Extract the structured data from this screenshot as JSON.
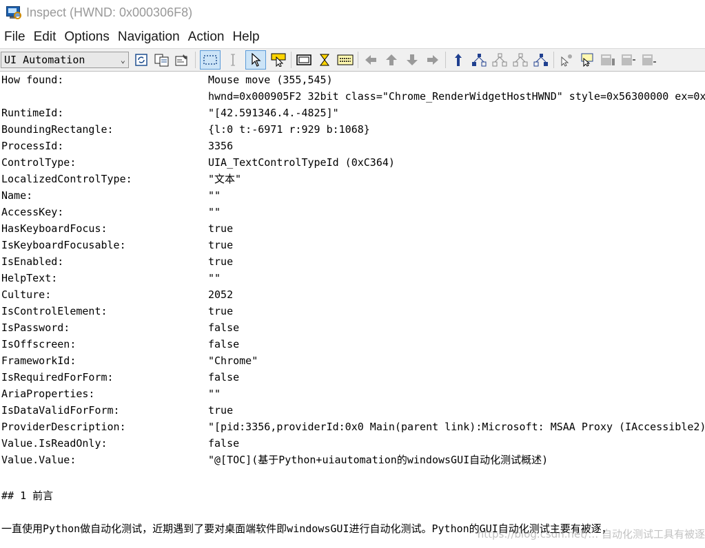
{
  "window": {
    "title": "Inspect  (HWND: 0x000306F8)",
    "icon": "inspect-app-icon"
  },
  "menu": [
    "File",
    "Edit",
    "Options",
    "Navigation",
    "Action",
    "Help"
  ],
  "toolbar": {
    "mode_selected": "UI Automation",
    "icons": [
      "refresh-icon",
      "copy-icon",
      "properties-icon",
      "watch-focus-icon",
      "watch-caret-icon",
      "watch-cursor-icon",
      "highlight-icon",
      "show-rectangle-icon",
      "hourglass-icon",
      "tooltip-icon",
      "navigate-left-icon",
      "navigate-up-icon",
      "navigate-down-icon",
      "navigate-right-icon",
      "parent-icon",
      "tree-first-child-icon",
      "tree-previous-icon",
      "tree-next-icon",
      "tree-last-child-icon",
      "default-action-icon",
      "select-icon",
      "scroll-icon",
      "expand-icon",
      "collapse-icon"
    ]
  },
  "properties": [
    {
      "key": "How found:",
      "value": "Mouse move (355,545)"
    },
    {
      "key": "",
      "value": "hwnd=0x000905F2 32bit class=\"Chrome_RenderWidgetHostHWND\" style=0x56300000 ex=0x"
    },
    {
      "key": "RuntimeId:",
      "value": "\"[42.591346.4.-4825]\""
    },
    {
      "key": "BoundingRectangle:",
      "value": "{l:0 t:-6971 r:929 b:1068}"
    },
    {
      "key": "ProcessId:",
      "value": "3356"
    },
    {
      "key": "ControlType:",
      "value": "UIA_TextControlTypeId (0xC364)"
    },
    {
      "key": "LocalizedControlType:",
      "value": "\"文本\""
    },
    {
      "key": "Name:",
      "value": "\"\""
    },
    {
      "key": "AccessKey:",
      "value": "\"\""
    },
    {
      "key": "HasKeyboardFocus:",
      "value": "true"
    },
    {
      "key": "IsKeyboardFocusable:",
      "value": "true"
    },
    {
      "key": "IsEnabled:",
      "value": "true"
    },
    {
      "key": "HelpText:",
      "value": "\"\""
    },
    {
      "key": "Culture:",
      "value": "2052"
    },
    {
      "key": "IsControlElement:",
      "value": "true"
    },
    {
      "key": "IsPassword:",
      "value": "false"
    },
    {
      "key": "IsOffscreen:",
      "value": "false"
    },
    {
      "key": "FrameworkId:",
      "value": "\"Chrome\""
    },
    {
      "key": "IsRequiredForForm:",
      "value": "false"
    },
    {
      "key": "AriaProperties:",
      "value": "\"\""
    },
    {
      "key": "IsDataValidForForm:",
      "value": "true"
    },
    {
      "key": "ProviderDescription:",
      "value": "\"[pid:3356,providerId:0x0 Main(parent link):Microsoft: MSAA Proxy (IAccessible2)"
    },
    {
      "key": "Value.IsReadOnly:",
      "value": "false"
    },
    {
      "key": "Value.Value:",
      "value": "\"@[TOC](基于Python+uiautomation的windowsGUI自动化测试概述)"
    }
  ],
  "text_lines": {
    "heading": "## 1 前言",
    "body": "一直使用Python做自动化测试，近期遇到了要对桌面端软件即windowsGUI进行自动化测试。Python的GUI自动化测试主要有被逐，"
  },
  "watermark": "https://blog.csdn.net/… 自动化测试工具有被逐"
}
